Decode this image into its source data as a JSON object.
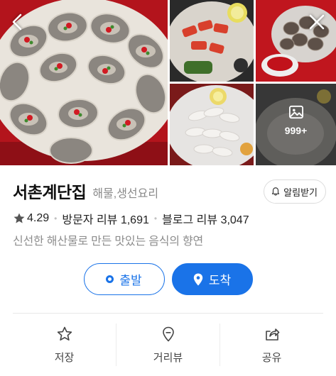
{
  "gallery": {
    "more_count": "999+",
    "icons": {
      "back": "chevron-left-icon",
      "close": "close-icon",
      "more": "image-icon"
    }
  },
  "place": {
    "name": "서촌계단집",
    "category": "해물,생선요리",
    "alarm_label": "알림받기",
    "rating": "4.29",
    "visitor_reviews": "방문자 리뷰 1,691",
    "blog_reviews": "블로그 리뷰 3,047",
    "description": "신선한 해산물로 만든 맛있는 음식의 향연"
  },
  "route": {
    "depart_label": "출발",
    "arrive_label": "도착"
  },
  "actions": {
    "save_label": "저장",
    "street_view_label": "거리뷰",
    "share_label": "공유"
  },
  "colors": {
    "accent": "#1a73e8",
    "muted_text": "#8a8a8a",
    "star": "#555555"
  }
}
